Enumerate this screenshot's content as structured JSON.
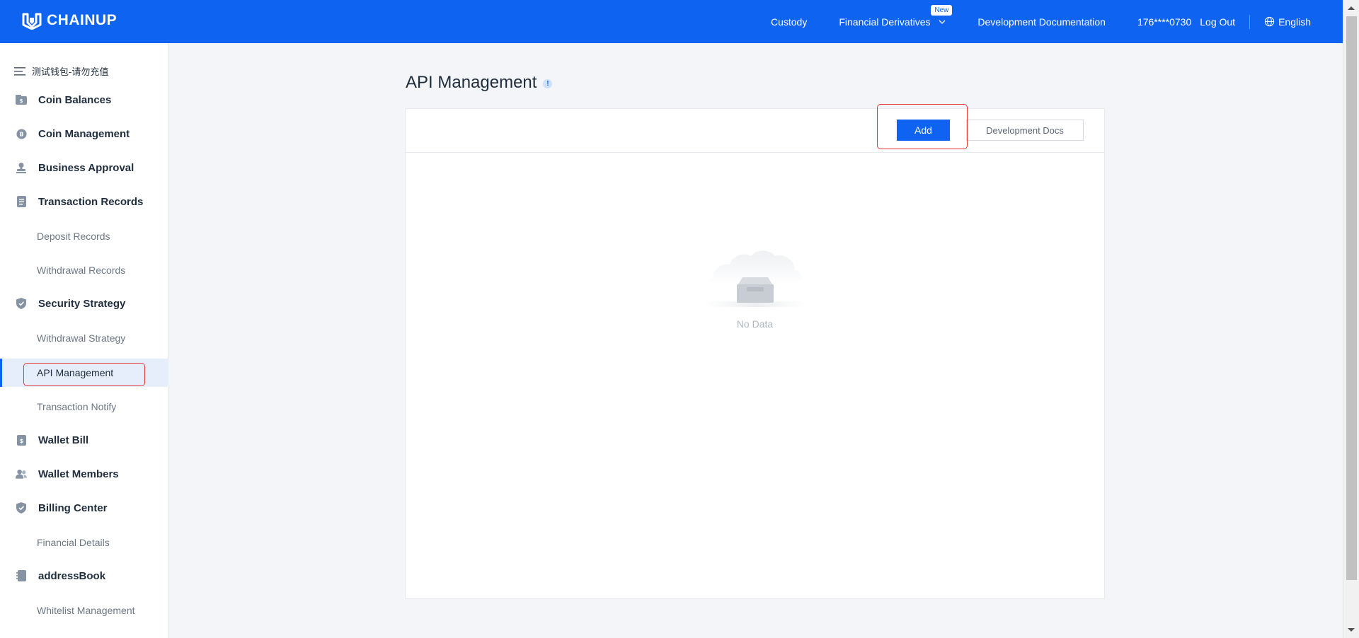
{
  "header": {
    "logo_text": "CHAINUP",
    "nav": {
      "custody": "Custody",
      "financial_derivatives": "Financial Derivatives",
      "new_badge": "New",
      "dev_documentation": "Development Documentation",
      "user": "176****0730",
      "logout": "Log Out",
      "language": "English"
    },
    "bg_color": "#0e64f0"
  },
  "sidebar": {
    "wallet_name": "测试钱包-请勿充值",
    "items": [
      {
        "label": "Coin Balances",
        "type": "group",
        "icon": "wallet-icon"
      },
      {
        "label": "Coin Management",
        "type": "group",
        "icon": "coin-icon"
      },
      {
        "label": "Business Approval",
        "type": "group",
        "icon": "stamp-icon"
      },
      {
        "label": "Transaction Records",
        "type": "group",
        "icon": "document-icon"
      },
      {
        "label": "Deposit Records",
        "type": "sub"
      },
      {
        "label": "Withdrawal Records",
        "type": "sub"
      },
      {
        "label": "Security Strategy",
        "type": "group",
        "icon": "shield-icon"
      },
      {
        "label": "Withdrawal Strategy",
        "type": "sub"
      },
      {
        "label": "API Management",
        "type": "sub",
        "active": true
      },
      {
        "label": "Transaction Notify",
        "type": "sub"
      },
      {
        "label": "Wallet Bill",
        "type": "group",
        "icon": "bill-icon"
      },
      {
        "label": "Wallet Members",
        "type": "group",
        "icon": "members-icon"
      },
      {
        "label": "Billing Center",
        "type": "group",
        "icon": "shield-icon"
      },
      {
        "label": "Financial Details",
        "type": "sub"
      },
      {
        "label": "addressBook",
        "type": "group",
        "icon": "address-book-icon"
      },
      {
        "label": "Whitelist Management",
        "type": "sub"
      }
    ]
  },
  "main": {
    "title": "API Management",
    "info_icon": "!",
    "add_button": "Add",
    "docs_button": "Development Docs",
    "empty_text": "No Data"
  },
  "colors": {
    "accent": "#0e64f0",
    "highlight": "#e53935"
  }
}
